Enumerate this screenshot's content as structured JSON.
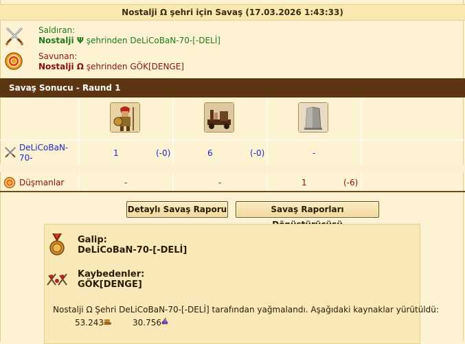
{
  "title": "Nostalji Ω şehri için Savaş (17.03.2026 1:43:33)",
  "attacker": {
    "role": "Saldıran:",
    "city": "Nostalji Ψ",
    "from_text": " şehrinden DeLiCoBaN-70-[-DELİ]",
    "icon": "crossed-swords-icon"
  },
  "defender": {
    "role": "Savunan:",
    "city": "Nostalji Ω",
    "from_text": " şehrinden GÖK[DENGE]",
    "icon": "shield-target-icon"
  },
  "result_header": "Savaş Sonucu - Raund 1",
  "units": [
    {
      "name": "hoplite-unit-icon"
    },
    {
      "name": "catapult-unit-icon"
    },
    {
      "name": "wall-unit-icon"
    }
  ],
  "rows": [
    {
      "name": "DeLiCoBaN-70-",
      "icon": "crossed-swords-icon",
      "cells": [
        {
          "count": "1",
          "loss": "(-0)"
        },
        {
          "count": "6",
          "loss": "(-0)"
        },
        {
          "count": "-",
          "loss": ""
        }
      ]
    },
    {
      "name": "Düşmanlar",
      "icon": "shield-target-icon",
      "cells": [
        {
          "count": "-",
          "loss": ""
        },
        {
          "count": "-",
          "loss": ""
        },
        {
          "count": "1",
          "loss": "(-6)"
        }
      ]
    }
  ],
  "buttons": {
    "detailed_report": "Detaylı Savaş Raporu",
    "converter": "Savaş Raporları Dönüştürücüsü"
  },
  "summary": {
    "winner_label": "Galip:",
    "winner": "DeLiCoBaN-70-[-DELİ]",
    "losers_label": "Kaybedenler:",
    "losers": "GÖK[DENGE]",
    "description": "Nostalji Ω Şehri DeLiCoBaN-70-[-DELİ] tarafından yağmalandı. Aşağıdaki kaynaklar yürütüldü:",
    "resources": [
      {
        "amount": "53.243",
        "icon": "wood-resource-icon"
      },
      {
        "amount": "30.756",
        "icon": "wine-resource-icon"
      }
    ]
  },
  "colors": {
    "header_bg": "#5c3612",
    "attacker": "#1f7a1f",
    "defender": "#8a1010",
    "link": "#1a2ac8",
    "page_bg": "#fdf3d3"
  }
}
